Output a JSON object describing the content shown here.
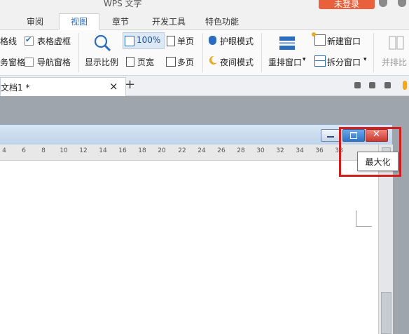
{
  "app": {
    "title": "WPS 文字",
    "login_label": "未登录"
  },
  "menu_tabs": [
    "审阅",
    "视图",
    "章节",
    "开发工具",
    "特色功能"
  ],
  "ribbon": {
    "line_partial": "格线",
    "table_gridlines": "表格虚框",
    "task_pane_partial": "务窗格",
    "nav_pane": "导航窗格",
    "zoom_label": "显示比例",
    "zoom_100": "100%",
    "single_page": "单页",
    "page_width": "页宽",
    "multi_page": "多页",
    "eye_mode": "护眼模式",
    "night_mode": "夜间模式",
    "arrange_windows": "重排窗口",
    "new_window": "新建窗口",
    "split_window": "拆分窗口",
    "side_by_side_partial": "并排比"
  },
  "document_tab": {
    "name": "文档1 *",
    "close": "×",
    "add": "+"
  },
  "ruler_ticks": [
    "4",
    "6",
    "8",
    "10",
    "12",
    "14",
    "16",
    "18",
    "20",
    "22",
    "24",
    "26",
    "28",
    "30",
    "32",
    "34",
    "36",
    "38"
  ],
  "tooltip": "最大化",
  "colors": {
    "accent": "#2a6cc0",
    "login": "#e8603c",
    "highlight": "#d11f1f",
    "close_btn": "#d9413b",
    "restore_btn": "#3f86d6"
  }
}
